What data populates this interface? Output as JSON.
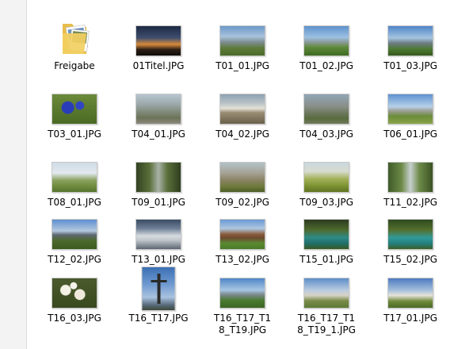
{
  "files": [
    {
      "name": "Freigabe",
      "kind": "folder"
    },
    {
      "name": "01Titel.JPG",
      "kind": "image",
      "bg": "linear-gradient(#1d2a44 0%, #3f4f6e 40%, #d78a3b 62%, #2b1e15 80%, #0f0c08 100%)"
    },
    {
      "name": "T01_01.JPG",
      "kind": "image",
      "bg": "linear-gradient(#6b98c9 0%, #a8c3dd 35%, #7c8c8e 55%, #5e7a3a 75%, #4b6b28 100%)"
    },
    {
      "name": "T01_02.JPG",
      "kind": "image",
      "bg": "linear-gradient(#5e92cc 0%, #9cc0e2 38%, #8a9a96 55%, #5f8a3a 72%, #3e6a22 100%)"
    },
    {
      "name": "T01_03.JPG",
      "kind": "image",
      "bg": "linear-gradient(#4f86c8 0%, #a5c4e0 40%, #6f7c82 58%, #4b7a32 78%, #35581d 100%)"
    },
    {
      "name": "T03_01.JPG",
      "kind": "image",
      "bg": "radial-gradient(circle at 35% 45%, #2a3db8 0 18%, transparent 20%), radial-gradient(circle at 62% 38%, #3146c2 0 12%, transparent 14%), linear-gradient(#6b8a3a, #4a6a24)"
    },
    {
      "name": "T04_01.JPG",
      "kind": "image",
      "bg": "linear-gradient(#b7c6cf 0%, #9aa6a8 35%, #7f8a7a 60%, #6b7357 80%, #8c8a7d 100%)"
    },
    {
      "name": "T04_02.JPG",
      "kind": "image",
      "bg": "linear-gradient(#8ca2b3 0%, #b9c2c6 30%, #e4e1d6 48%, #9a8d74 62%, #6a5f4a 100%)"
    },
    {
      "name": "T04_03.JPG",
      "kind": "image",
      "bg": "linear-gradient(#90a6b4 0%, #8a8f8a 40%, #6e7a60 62%, #596b3e 82%, #6f7a5a 100%)"
    },
    {
      "name": "T06_01.JPG",
      "kind": "image",
      "bg": "linear-gradient(#5d92d1 0%, #b8d0e8 42%, #9d9f97 56%, #6c8c3a 74%, #88a448 100%)"
    },
    {
      "name": "T08_01.JPG",
      "kind": "image",
      "bg": "linear-gradient(#cfdbe6 0%, #e3e9ee 36%, #8aa15f 60%, #6f8c3e 80%, #56742e 100%)"
    },
    {
      "name": "T09_01.JPG",
      "kind": "image",
      "bg": "linear-gradient(90deg, #334222 0%, #5a6f3a 30%, #a9b2a8 50%, #5a6f3a 70%, #2f3e1f 100%)"
    },
    {
      "name": "T09_02.JPG",
      "kind": "image",
      "bg": "linear-gradient(#b4c2c9 0%, #a5a295 35%, #8a8262 60%, #6d7a3c 82%, #4d5e25 100%)"
    },
    {
      "name": "T09_03.JPG",
      "kind": "image",
      "bg": "linear-gradient(#c9d7df 0%, #d7dccf 30%, #a4b15a 55%, #7f9533 78%, #5f7422 100%)"
    },
    {
      "name": "T11_02.JPG",
      "kind": "image",
      "bg": "linear-gradient(90deg, #3f5a2a 0%, #6d8a48 30%, #c7d0cf 50%, #6d8a48 70%, #3a5224 100%)"
    },
    {
      "name": "T12_02.JPG",
      "kind": "image",
      "bg": "linear-gradient(#5e8fd0 0%, #b4c9de 38%, #5e6770 52%, #4b6a2a 72%, #3b5a1f 100%)"
    },
    {
      "name": "T13_01.JPG",
      "kind": "image",
      "bg": "linear-gradient(#3a4c63 0%, #6e7f96 30%, #d6dbe0 55%, #c1c6cc 70%, #5c6672 100%)"
    },
    {
      "name": "T13_02.JPG",
      "kind": "image",
      "bg": "linear-gradient(#6a9ad4 0%, #aec7e0 30%, #8a5a3a 50%, #6d4a30 62%, #5a8a32 80%, #4b7a28 100%)"
    },
    {
      "name": "T15_01.JPG",
      "kind": "image",
      "bg": "linear-gradient(#2c3b1f 0%, #4e6a2e 35%, #2e8a86 60%, #1f6f6c 80%, #3a5a22 100%)"
    },
    {
      "name": "T15_02.JPG",
      "kind": "image",
      "bg": "linear-gradient(#2d4a1e 0%, #55702e 35%, #2f9a9a 62%, #237e7a 82%, #3e5f26 100%)"
    },
    {
      "name": "T16_03.JPG",
      "kind": "image",
      "bg": "radial-gradient(circle at 30% 40%, #f4f1e6 0 14%, transparent 16%), radial-gradient(circle at 62% 55%, #efeadb 0 16%, transparent 18%), radial-gradient(circle at 48% 25%, #f6f3ea 0 10%, transparent 12%), linear-gradient(#4a5a2c, #3a4a20)"
    },
    {
      "name": "T16_T17.JPG",
      "kind": "portrait",
      "bg": "linear-gradient(#3b6fb4 0%, #6f9ad0 40%, #a9c2df 70%, #586a7a 88%, #3c4a3a 100%)"
    },
    {
      "name": "T16_T17_T18_T19.JPG",
      "kind": "image",
      "bg": "linear-gradient(#4f86c8 0%, #a8c6e2 40%, #7b8a8f 55%, #4a7a30 75%, #3a6524 100%)"
    },
    {
      "name": "T16_T17_T18_T19_1.JPG",
      "kind": "image",
      "bg": "linear-gradient(#5d8ec8 0%, #b9cbe0 40%, #d7d3c6 58%, #7a8c4a 76%, #5c7a34 100%)"
    },
    {
      "name": "T17_01.JPG",
      "kind": "image",
      "bg": "linear-gradient(#4e7bc0 0%, #a3bedc 40%, #e7e3da 58%, #6f8a3a 78%, #4c6a26 100%)"
    }
  ]
}
